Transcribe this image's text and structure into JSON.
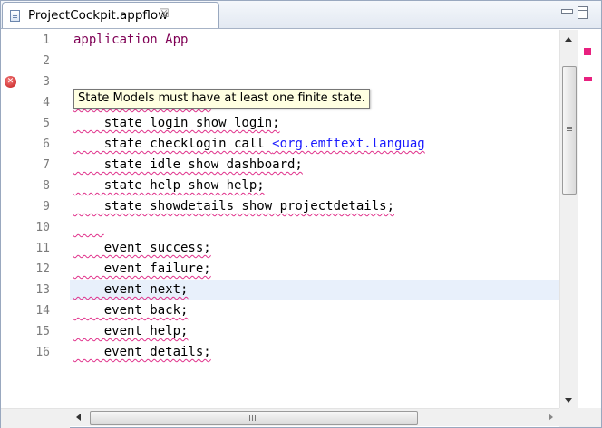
{
  "tab": {
    "title": "ProjectCockpit.appflow",
    "close_glyph": "☒"
  },
  "tooltip": {
    "text": "State Models must have at least one finite state."
  },
  "colors": {
    "keyword": "#7f0055",
    "error_underline": "#e0308a",
    "current_line": "#e8f0fb",
    "link": "#1a1aff"
  },
  "icons": {
    "file": "appflow-file-icon",
    "error": "error-marker-icon",
    "close": "close-icon"
  },
  "lines": [
    {
      "n": "1",
      "text": "application App"
    },
    {
      "n": "2",
      "text": ""
    },
    {
      "n": "3",
      "text": ""
    },
    {
      "n": "4",
      "text": "    state initial;"
    },
    {
      "n": "5",
      "text": "    state login show login;"
    },
    {
      "n": "6",
      "text": "    state checklogin call ",
      "link": "<org.emftext.languag"
    },
    {
      "n": "7",
      "text": "    state idle show dashboard;"
    },
    {
      "n": "8",
      "text": "    state help show help;"
    },
    {
      "n": "9",
      "text": "    state showdetails show projectdetails;"
    },
    {
      "n": "10",
      "text": ""
    },
    {
      "n": "11",
      "text": "    event success;"
    },
    {
      "n": "12",
      "text": "    event failure;"
    },
    {
      "n": "13",
      "text": "    event next;"
    },
    {
      "n": "14",
      "text": "    event back;"
    },
    {
      "n": "15",
      "text": "    event help;"
    },
    {
      "n": "16",
      "text": "    event details;"
    }
  ]
}
